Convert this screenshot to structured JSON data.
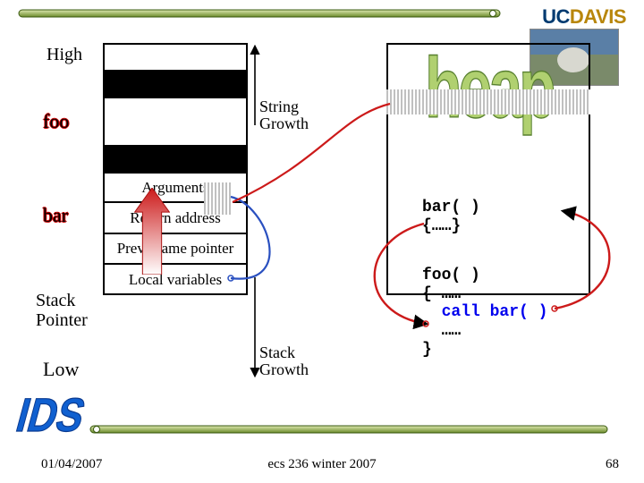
{
  "labels": {
    "high": "High",
    "foo": "foo",
    "bar": "bar",
    "stack_pointer": "Stack\nPointer",
    "low": "Low"
  },
  "stack_cells": {
    "arguments": "Arguments",
    "return_addr": "Return address",
    "prev_fp": "Prev. frame pointer",
    "local_vars": "Local variables"
  },
  "annotations": {
    "string_growth": "String\nGrowth",
    "stack_growth": "Stack\nGrowth",
    "heap_word": "heap"
  },
  "code": {
    "bar": "bar( )\n{……}",
    "foo_l1": "foo( )",
    "foo_l2": "{ ……",
    "foo_l3": "  call bar( )",
    "foo_l4": "  ……",
    "foo_l5": "}"
  },
  "logo": {
    "uc": "UC",
    "davis": "DAVIS"
  },
  "footer": {
    "date": "01/04/2007",
    "course": "ecs 236 winter 2007",
    "page": "68"
  },
  "decor": {
    "ids": "IDS"
  }
}
